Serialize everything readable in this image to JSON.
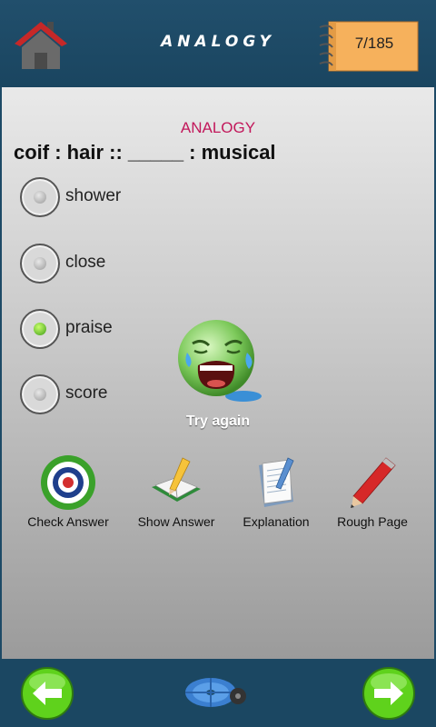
{
  "header": {
    "title": "ANALOGY",
    "counter": "7/185"
  },
  "content": {
    "subtitle": "ANALOGY",
    "question": "coif : hair :: _____ : musical",
    "options": [
      {
        "label": "shower",
        "selected": false
      },
      {
        "label": "close",
        "selected": false
      },
      {
        "label": "praise",
        "selected": true
      },
      {
        "label": "score",
        "selected": false
      }
    ],
    "feedback": "Try again"
  },
  "tools": [
    {
      "label": "Check Answer",
      "icon": "target-icon"
    },
    {
      "label": "Show Answer",
      "icon": "book-pencil-icon"
    },
    {
      "label": "Explanation",
      "icon": "notepad-icon"
    },
    {
      "label": "Rough Page",
      "icon": "pencil-icon"
    }
  ],
  "footer": {
    "prev_icon": "arrow-left-icon",
    "next_icon": "arrow-right-icon",
    "settings_icon": "gear-icon"
  },
  "colors": {
    "header_bg": "#1d4a66",
    "subtitle": "#c2185b",
    "nav_button": "#5fd21c",
    "counter_pad": "#f2a84f"
  }
}
